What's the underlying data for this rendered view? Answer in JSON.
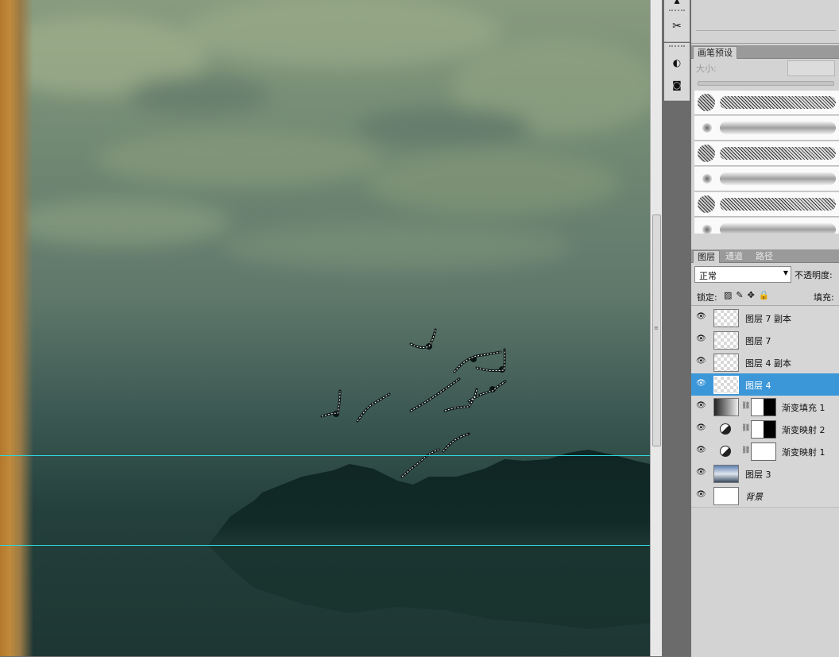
{
  "brush_panel": {
    "tab_label": "画笔预设",
    "size_label": "大小:"
  },
  "layers_panel": {
    "tabs": [
      "图层",
      "通道",
      "路径"
    ],
    "blend_mode": "正常",
    "opacity_label": "不透明度:",
    "lock_label": "锁定:",
    "fill_label": "填充:",
    "layers": [
      {
        "name": "图层 7 副本",
        "kind": "pixel",
        "selected": false
      },
      {
        "name": "图层 7",
        "kind": "pixel",
        "selected": false
      },
      {
        "name": "图层 4 副本",
        "kind": "pixel",
        "selected": false
      },
      {
        "name": "图层 4",
        "kind": "pixel",
        "selected": true
      },
      {
        "name": "渐变填充 1",
        "kind": "gradient-fill",
        "selected": false
      },
      {
        "name": "渐变映射 2",
        "kind": "adjustment",
        "selected": false
      },
      {
        "name": "渐变映射 1",
        "kind": "adjustment",
        "selected": false
      },
      {
        "name": "图层 3",
        "kind": "image",
        "selected": false
      },
      {
        "name": "背景",
        "kind": "background",
        "selected": false
      }
    ]
  },
  "colors": {
    "selection_blue": "#3c97d8",
    "guide_cyan": "#2fd8dc"
  }
}
